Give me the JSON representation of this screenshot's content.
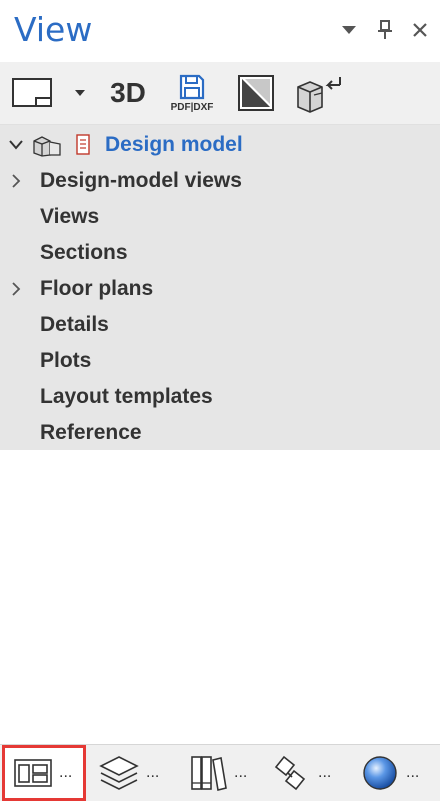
{
  "panel": {
    "title": "View"
  },
  "header_buttons": [
    {
      "name": "dropdown-arrow-icon"
    },
    {
      "name": "pin-icon"
    },
    {
      "name": "close-icon"
    }
  ],
  "toolbar": {
    "view_3d_label": "3D",
    "pdf_dxf_label": "PDF|DXF"
  },
  "tree": {
    "root": {
      "label": "Design model",
      "expanded": true
    },
    "items": [
      {
        "label": "Design-model views",
        "expandable": true
      },
      {
        "label": "Views",
        "expandable": false
      },
      {
        "label": "Sections",
        "expandable": false
      },
      {
        "label": "Floor plans",
        "expandable": true
      },
      {
        "label": "Details",
        "expandable": false
      },
      {
        "label": "Plots",
        "expandable": false
      },
      {
        "label": "Layout templates",
        "expandable": false
      },
      {
        "label": "Reference",
        "expandable": false
      }
    ]
  },
  "bottom_tabs": [
    {
      "icon": "view-layout-icon",
      "dots": "...",
      "active": true
    },
    {
      "icon": "layers-icon",
      "dots": "...",
      "active": false
    },
    {
      "icon": "library-icon",
      "dots": "...",
      "active": false
    },
    {
      "icon": "objects-icon",
      "dots": "...",
      "active": false
    },
    {
      "icon": "sphere-icon",
      "dots": "...",
      "active": false
    }
  ],
  "colors": {
    "title": "#2b6cc4",
    "root_label": "#2b6cc4",
    "tree_background": "#e6e6e6",
    "toolbar_background": "#f0f0f0",
    "active_tab_border": "#e53935"
  }
}
